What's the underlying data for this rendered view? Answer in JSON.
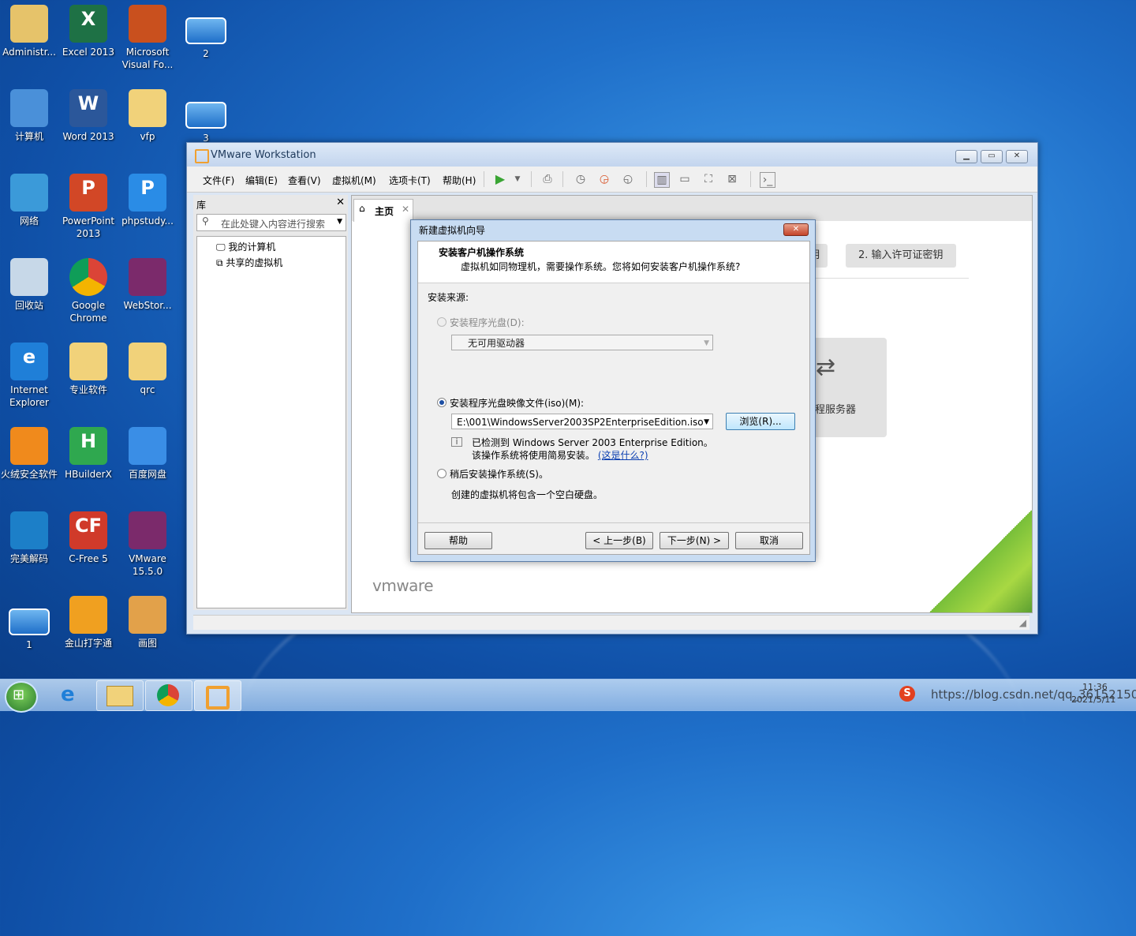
{
  "desktop": {
    "icons": [
      {
        "label": "Administr...",
        "icon": "user-folder-icon"
      },
      {
        "label": "Excel 2013",
        "icon": "excel-icon"
      },
      {
        "label": "Microsoft Visual Fo...",
        "icon": "foxpro-icon"
      },
      {
        "label": "2",
        "icon": "screenshot-icon"
      },
      {
        "label": "计算机",
        "icon": "computer-icon"
      },
      {
        "label": "Word 2013",
        "icon": "word-icon"
      },
      {
        "label": "vfp",
        "icon": "folder-icon"
      },
      {
        "label": "3",
        "icon": "screenshot-icon"
      },
      {
        "label": "网络",
        "icon": "network-icon"
      },
      {
        "label": "PowerPoint 2013",
        "icon": "powerpoint-icon"
      },
      {
        "label": "phpstudy...",
        "icon": "phpstudy-icon"
      },
      {
        "label": "回收站",
        "icon": "recycle-bin-icon"
      },
      {
        "label": "Google Chrome",
        "icon": "chrome-icon"
      },
      {
        "label": "WebStor...",
        "icon": "winrar-icon"
      },
      {
        "label": "Internet Explorer",
        "icon": "ie-icon"
      },
      {
        "label": "专业软件",
        "icon": "folder-icon"
      },
      {
        "label": "qrc",
        "icon": "folder-icon"
      },
      {
        "label": "火绒安全软件",
        "icon": "huorong-icon"
      },
      {
        "label": "HBuilderX",
        "icon": "hbuilder-icon"
      },
      {
        "label": "百度网盘",
        "icon": "baidu-netdisk-icon"
      },
      {
        "label": "完美解码",
        "icon": "media-player-icon"
      },
      {
        "label": "C-Free 5",
        "icon": "cfree-icon"
      },
      {
        "label": "VMware 15.5.0",
        "icon": "winrar-icon"
      },
      {
        "label": "1",
        "icon": "screenshot-icon"
      },
      {
        "label": "金山打字通",
        "icon": "typing-icon"
      },
      {
        "label": "画图",
        "icon": "paint-icon"
      }
    ]
  },
  "vmware": {
    "title": "VMware Workstation",
    "menu": [
      "文件(F)",
      "编辑(E)",
      "查看(V)",
      "虚拟机(M)",
      "选项卡(T)",
      "帮助(H)"
    ],
    "library": {
      "title": "库",
      "search_placeholder": "在此处键入内容进行搜索",
      "items": [
        "我的计算机",
        "共享的虚拟机"
      ]
    },
    "tab_home": "主页",
    "home_buttons": [
      "明",
      "2. 输入许可证密钥"
    ],
    "remote_label": "远程服务器",
    "wordmark": "vmware"
  },
  "wizard": {
    "title": "新建虚拟机向导",
    "heading": "安装客户机操作系统",
    "subheading": "虚拟机如同物理机，需要操作系统。您将如何安装客户机操作系统?",
    "source_label": "安装来源:",
    "option_disc": "安装程序光盘(D):",
    "disc_value": "无可用驱动器",
    "option_iso": "安装程序光盘映像文件(iso)(M):",
    "iso_value": "E:\\001\\WindowsServer2003SP2EnterpriseEdition.iso",
    "browse": "浏览(R)...",
    "detected": "已检测到 Windows Server 2003 Enterprise Edition。",
    "easy_install": "该操作系统将使用简易安装。",
    "what_is_this": "(这是什么?)",
    "option_later": "稍后安装操作系统(S)。",
    "later_desc": "创建的虚拟机将包含一个空白硬盘。",
    "btn_help": "帮助",
    "btn_back": "< 上一步(B)",
    "btn_next": "下一步(N) >",
    "btn_cancel": "取消",
    "selected": "iso"
  },
  "taskbar": {
    "watermark": "https://blog.csdn.net/qq_36152150",
    "time": "11:36",
    "date": "2021/5/11"
  }
}
